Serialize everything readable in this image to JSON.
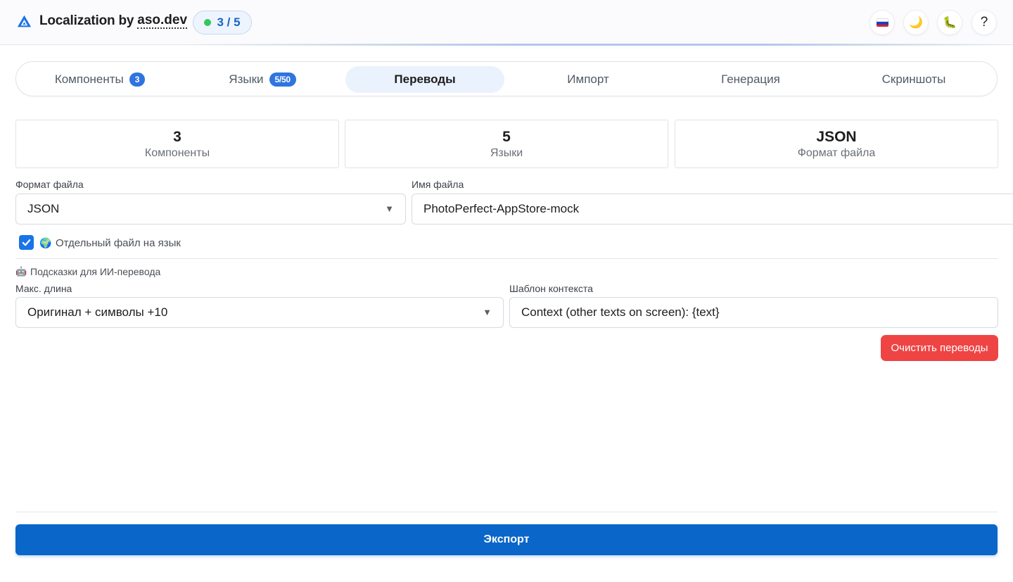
{
  "header": {
    "brand_text": "Localization by",
    "brand_link": "aso.dev",
    "progress": "3 / 5",
    "buttons": [
      {
        "icon": "russia-flag-icon"
      },
      {
        "icon": "moon-icon",
        "glyph": "🌙"
      },
      {
        "icon": "bug-icon",
        "glyph": "🐛"
      },
      {
        "icon": "help-icon",
        "glyph": "?"
      }
    ]
  },
  "tabs": [
    {
      "label": "Компоненты",
      "badge": "3"
    },
    {
      "label": "Языки",
      "badge": "5/50"
    },
    {
      "label": "Переводы",
      "active": true
    },
    {
      "label": "Импорт"
    },
    {
      "label": "Генерация"
    },
    {
      "label": "Скриншоты"
    }
  ],
  "stats": [
    {
      "value": "3",
      "label": "Компоненты"
    },
    {
      "value": "5",
      "label": "Языки"
    },
    {
      "value": "JSON",
      "label": "Формат файла"
    }
  ],
  "form": {
    "format_label": "Формат файла",
    "format_value": "JSON",
    "filename_label": "Имя файла",
    "filename_value": "PhotoPerfect-AppStore-mock",
    "separate_file_label": "Отдельный файл на язык",
    "separate_file_checked": true,
    "ai_hints_label": "Подсказки для ИИ-перевода",
    "max_length_label": "Макс. длина",
    "max_length_value": "Оригинал + символы +10",
    "context_label": "Шаблон контекста",
    "context_value": "Context (other texts on screen): {text}"
  },
  "actions": {
    "clear_label": "Очистить переводы",
    "export_label": "Экспорт"
  },
  "colors": {
    "accent": "#0a66c8",
    "danger": "#ef4444",
    "badge": "#2f74e0",
    "success_dot": "#34c759"
  }
}
